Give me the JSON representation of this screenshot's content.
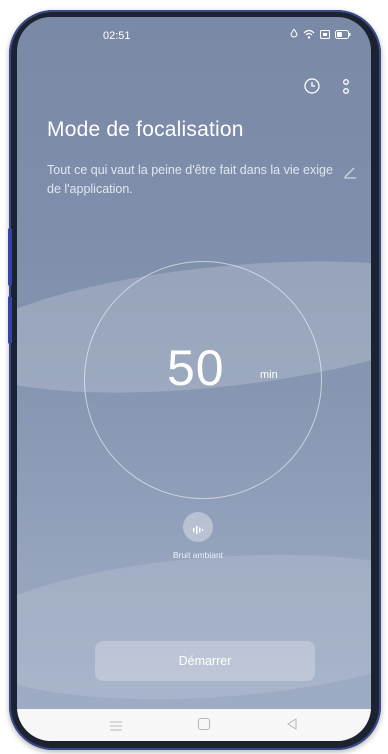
{
  "status_bar": {
    "time": "02:51",
    "icons": [
      "drop-icon",
      "wifi-icon",
      "sim-icon",
      "battery-icon"
    ]
  },
  "header": {
    "icons": [
      "clock-icon",
      "more-vert-icon"
    ]
  },
  "main": {
    "title": "Mode de focalisation",
    "quote": "Tout ce qui vaut la peine d'être fait dans la vie exige de l'application.",
    "timer": {
      "value": "50",
      "unit": "min"
    },
    "ambient": {
      "label": "Bruit ambiant",
      "icon": "sound-wave-icon"
    },
    "start_button": "Démarrer"
  },
  "nav_bar": {
    "icons": [
      "menu-icon",
      "home-icon",
      "back-icon"
    ]
  },
  "colors": {
    "background_top": "#7a8aa6",
    "background_bottom": "#9fadc6",
    "text": "#ffffff",
    "device_frame": "#1c2230",
    "side_button": "#3444a8"
  }
}
